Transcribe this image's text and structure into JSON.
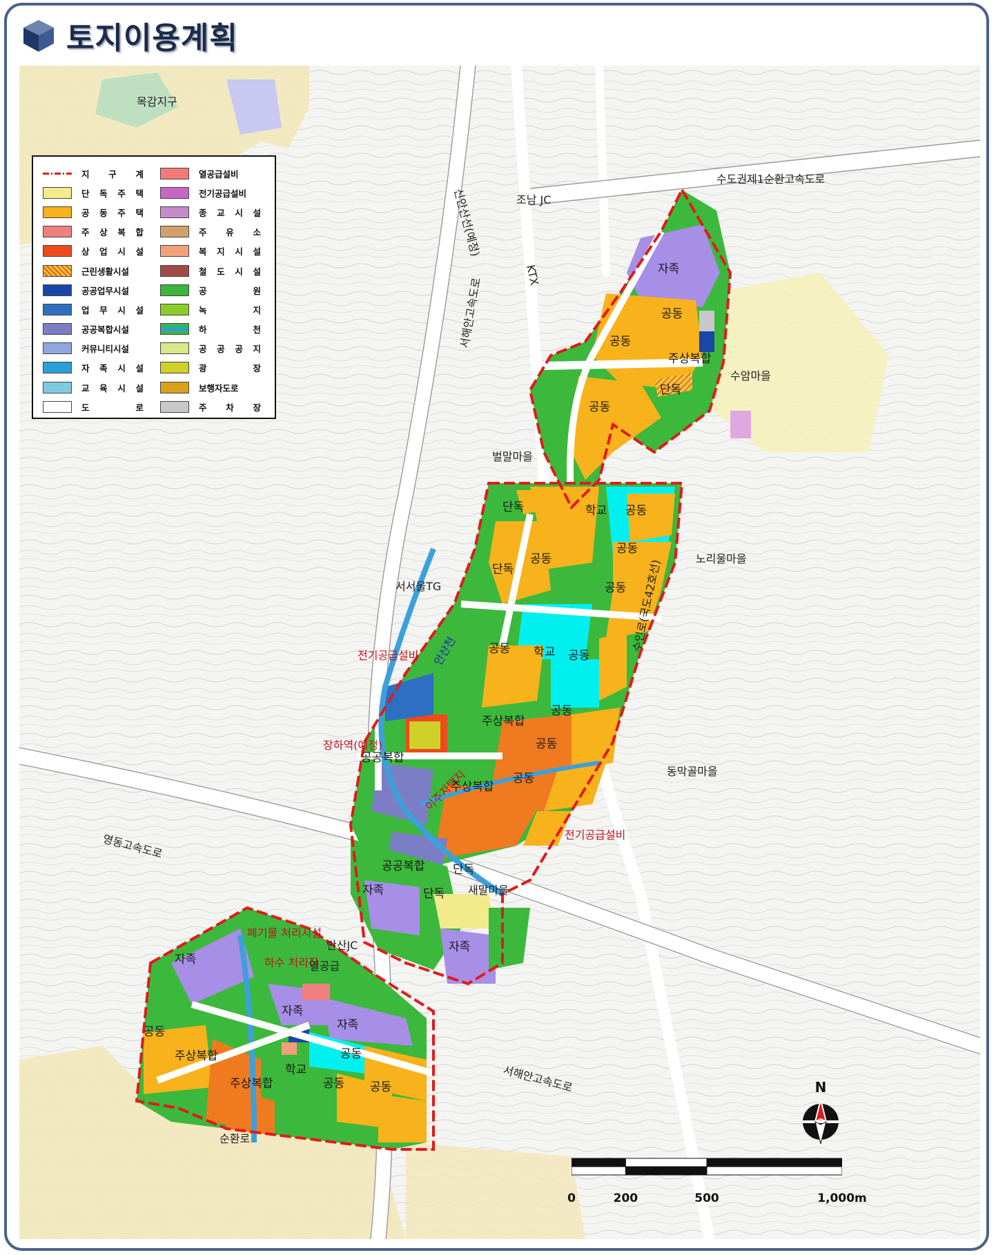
{
  "title": "토지이용계획",
  "legend": {
    "items": [
      {
        "label": "지 구 계",
        "color": "boundary"
      },
      {
        "label": "단 독 주 택",
        "color": "#f3ea8c"
      },
      {
        "label": "공 동 주 택",
        "color": "#f7b21c"
      },
      {
        "label": "주 상 복 합",
        "color": "#f08080"
      },
      {
        "label": "상 업 시 설",
        "color": "#ee4a1b"
      },
      {
        "label": "근린생활시설",
        "color": "hatch-orange"
      },
      {
        "label": "공공업무시설",
        "color": "#1847a8"
      },
      {
        "label": "업 무 시 설",
        "color": "#2f6fc2"
      },
      {
        "label": "공공복합시설",
        "color": "#7b7ec4"
      },
      {
        "label": "커뮤니티시설",
        "color": "#8fa6df"
      },
      {
        "label": "자 족 시 설",
        "color": "#2aa0d8"
      },
      {
        "label": "교 육 시 설",
        "color": "#7ecbe0"
      },
      {
        "label": "도 로",
        "color": "#ffffff"
      },
      {
        "label": "열공급설비",
        "color": "#f27a7a"
      },
      {
        "label": "전기공급설비",
        "color": "#c567c5"
      },
      {
        "label": "종 교 시 설",
        "color": "#c58ac8"
      },
      {
        "label": "주 유 소",
        "color": "#d4a06a"
      },
      {
        "label": "복 지 시 설",
        "color": "#f2a07a"
      },
      {
        "label": "철 도 시 설",
        "color": "#a24a4a"
      },
      {
        "label": "공 원",
        "color": "#3bb53b"
      },
      {
        "label": "녹 지",
        "color": "#8ccc2a"
      },
      {
        "label": "하 천",
        "color": "river"
      },
      {
        "label": "공 공 공 지",
        "color": "#d7e88a"
      },
      {
        "label": "광 장",
        "color": "#d0d02a"
      },
      {
        "label": "보행자도로",
        "color": "#d9a01a"
      },
      {
        "label": "주 차 장",
        "color": "#c8c8c8"
      }
    ]
  },
  "map_labels": {
    "mokgam": "목감지구",
    "sinansan": "신안산선(예정)",
    "josan_jc": "조남 JC",
    "ktx": "KTX",
    "seohaean_n": "서해안고속도로",
    "sudogwon": "수도권제1순환고속도로",
    "suam": "수암마을",
    "beolmal": "벌말마을",
    "noriul": "노리울마을",
    "seoseoul_tg": "서서울TG",
    "road42": "수인로(국도42호선)",
    "jeongi1": "전기공급설비",
    "ansancheon": "안산천",
    "jangha": "장하역(예정)",
    "ijuja": "이주자택지",
    "dongmak": "동막골마을",
    "jeongi2": "전기공급설비",
    "yeongdong": "영동고속도로",
    "saemal": "새말마을",
    "ansan_jc": "안산JC",
    "pyegimul": "폐기물 처리시설",
    "hasu": "하수 처리장",
    "yeolgonggeup": "열공급",
    "seohaean_s": "서해안고속도로",
    "sunhwanro": "순환로"
  },
  "zone_labels": {
    "jajok": "자족",
    "gongdong": "공동",
    "jusang": "주상복합",
    "dandok": "단독",
    "hakgyo": "학교",
    "gonggong": "공공복합"
  },
  "north_label": "N",
  "scale": {
    "ticks": [
      "0",
      "200",
      "500",
      "1,000m"
    ],
    "values": [
      0,
      200,
      500,
      1000
    ]
  }
}
